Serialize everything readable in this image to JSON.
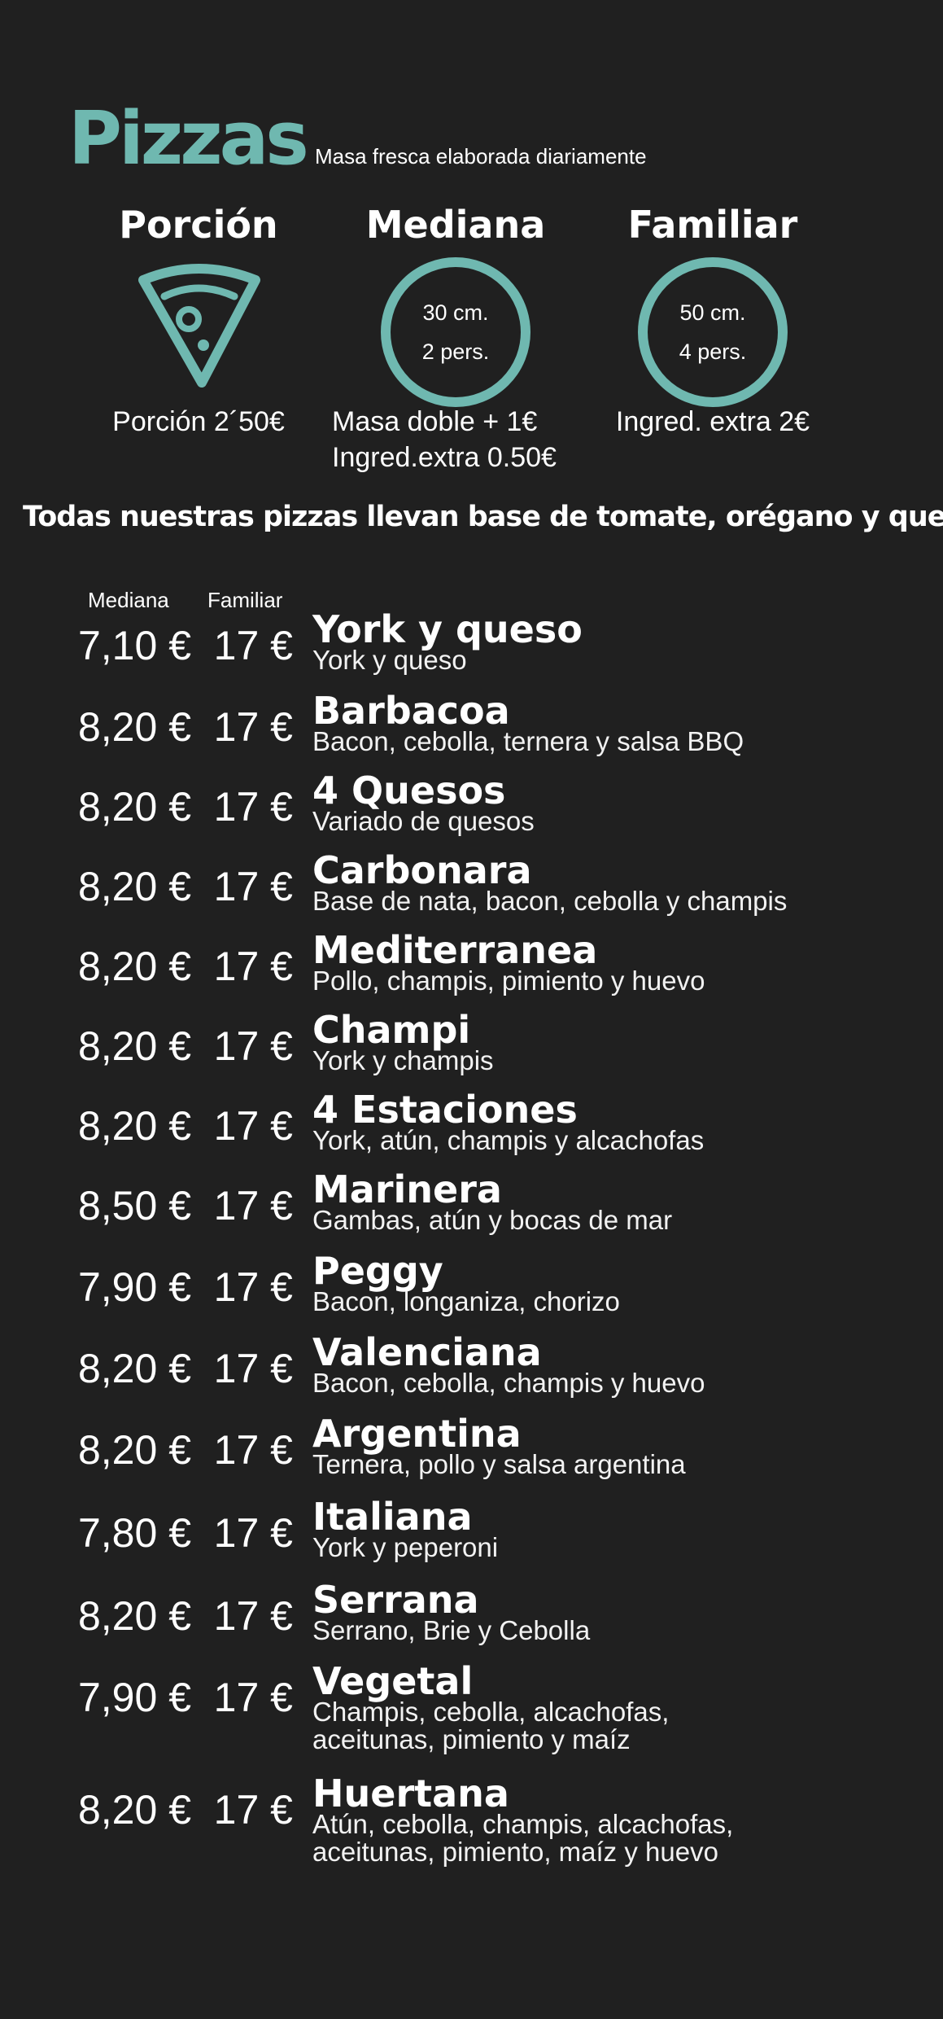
{
  "header": {
    "title": "Pizzas",
    "subtitle": "Masa fresca elaborada diariamente"
  },
  "sizes": [
    {
      "name": "Porción",
      "graphic": "pizza-slice-icon",
      "notes": [
        "Porción 2´50€"
      ]
    },
    {
      "name": "Mediana",
      "graphic": "size-circle",
      "diameter": "30 cm.",
      "people": "2 pers.",
      "notes": [
        "Masa doble + 1€",
        "Ingred.extra 0.50€"
      ]
    },
    {
      "name": "Familiar",
      "graphic": "size-circle",
      "diameter": "50 cm.",
      "people": "4 pers.",
      "notes": [
        "Ingred. extra 2€"
      ]
    }
  ],
  "base_note": "Todas nuestras pizzas llevan base de tomate, orégano y queso",
  "columns": {
    "mediana": "Mediana",
    "familiar": "Familiar"
  },
  "items": [
    {
      "name": "York y queso",
      "desc": "York y queso",
      "mediana": "7,10 €",
      "familiar": "17 €"
    },
    {
      "name": "Barbacoa",
      "desc": "Bacon, cebolla, ternera y salsa BBQ",
      "mediana": "8,20 €",
      "familiar": "17 €"
    },
    {
      "name": "4 Quesos",
      "desc": "Variado de quesos",
      "mediana": "8,20 €",
      "familiar": "17 €"
    },
    {
      "name": "Carbonara",
      "desc": "Base de nata, bacon, cebolla y champis",
      "mediana": "8,20 €",
      "familiar": "17 €"
    },
    {
      "name": "Mediterranea",
      "desc": "Pollo, champis, pimiento y huevo",
      "mediana": "8,20 €",
      "familiar": "17 €"
    },
    {
      "name": "Champi",
      "desc": "York y champis",
      "mediana": "8,20 €",
      "familiar": "17 €"
    },
    {
      "name": "4 Estaciones",
      "desc": "York, atún, champis y alcachofas",
      "mediana": "8,20 €",
      "familiar": "17 €"
    },
    {
      "name": "Marinera",
      "desc": "Gambas, atún y bocas de mar",
      "mediana": "8,50 €",
      "familiar": "17 €"
    },
    {
      "name": "Peggy",
      "desc": "Bacon, longaniza, chorizo",
      "mediana": "7,90 €",
      "familiar": "17 €"
    },
    {
      "name": "Valenciana",
      "desc": "Bacon, cebolla, champis y huevo",
      "mediana": "8,20 €",
      "familiar": "17 €"
    },
    {
      "name": "Argentina",
      "desc": "Ternera, pollo y salsa argentina",
      "mediana": "8,20 €",
      "familiar": "17 €"
    },
    {
      "name": "Italiana",
      "desc": "York y peperoni",
      "mediana": "7,80 €",
      "familiar": "17 €"
    },
    {
      "name": "Serrana",
      "desc": "Serrano, Brie y Cebolla",
      "mediana": "8,20 €",
      "familiar": "17 €"
    },
    {
      "name": "Vegetal",
      "desc": "Champis, cebolla, alcachofas, aceitunas, pimiento y maíz",
      "mediana": "7,90 €",
      "familiar": "17 €"
    },
    {
      "name": "Huertana",
      "desc": "Atún, cebolla, champis, alcachofas, aceitunas, pimiento, maíz y huevo",
      "mediana": "8,20 €",
      "familiar": "17 €"
    }
  ],
  "colors": {
    "background": "#202020",
    "accent": "#6fb8b0",
    "text": "#ffffff"
  }
}
